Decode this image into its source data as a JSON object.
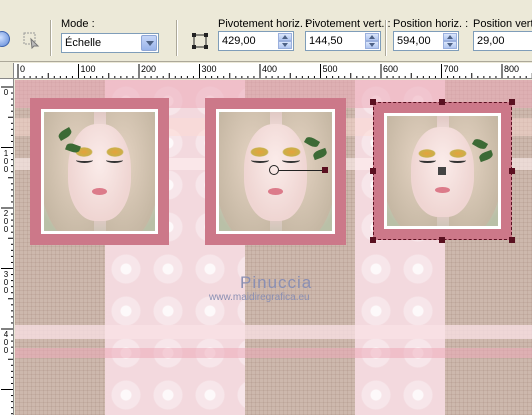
{
  "toolbar": {
    "mode_label": "Mode :",
    "mode_value": "Échelle",
    "pivot_h_label": "Pivotement horiz. :",
    "pivot_h_value": "429,00",
    "pivot_v_label": "Pivotement vert. :",
    "pivot_v_value": "144,50",
    "pos_h_label": "Position horiz. :",
    "pos_h_value": "594,00",
    "pos_v_label": "Position vert. :",
    "pos_v_value": "29,00"
  },
  "ruler_h": [
    "0",
    "100",
    "200",
    "300",
    "400",
    "500",
    "600",
    "700",
    "800"
  ],
  "ruler_v": [
    "0",
    "100",
    "200",
    "300",
    "400"
  ],
  "watermark": {
    "name": "Pinuccia",
    "url": "www.maidiregrafica.eu"
  },
  "icons": [
    "refresh-icon",
    "pick-tool-icon",
    "center-pivot-icon"
  ],
  "colors": {
    "frame": "#cc7889",
    "selection": "#5a1020",
    "canvas": "#cdb8ad"
  }
}
